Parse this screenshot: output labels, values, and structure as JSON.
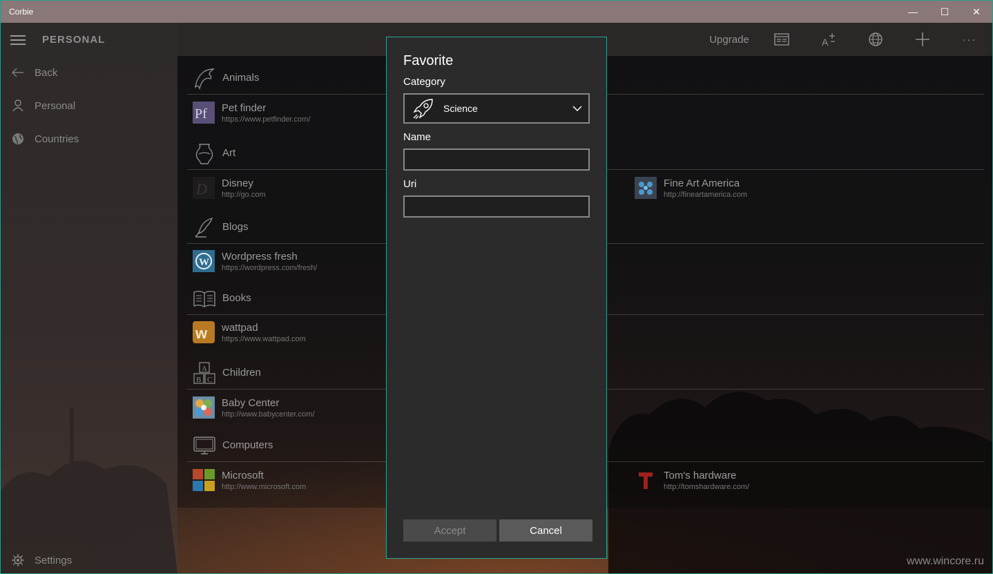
{
  "window": {
    "title": "Corbie",
    "minimize": "—",
    "maximize": "☐",
    "close": "✕"
  },
  "sidebar": {
    "section_title": "PERSONAL",
    "items": [
      {
        "label": "Back",
        "icon": "back-arrow-icon"
      },
      {
        "label": "Personal",
        "icon": "person-icon"
      },
      {
        "label": "Countries",
        "icon": "globe-icon"
      }
    ],
    "settings_label": "Settings"
  },
  "toolbar": {
    "upgrade_label": "Upgrade",
    "more_label": "···"
  },
  "categories": [
    {
      "label": "Animals",
      "icon": "dolphin-icon"
    },
    {
      "label": "Art",
      "icon": "vase-icon"
    },
    {
      "label": "Blogs",
      "icon": "quill-icon"
    },
    {
      "label": "Books",
      "icon": "open-book-icon"
    },
    {
      "label": "Children",
      "icon": "abc-blocks-icon"
    },
    {
      "label": "Computers",
      "icon": "monitor-icon"
    }
  ],
  "favorites": [
    {
      "name": "Pet finder",
      "url": "https://www.petfinder.com/",
      "icon": "petfinder-logo"
    },
    {
      "name": "Disney",
      "url": "http://go.com",
      "icon": "disney-logo"
    },
    {
      "name": "Fine Art America",
      "url": "http://fineartamerica.com",
      "icon": "fineartamerica-logo"
    },
    {
      "name": "Wordpress fresh",
      "url": "https://wordpress.com/fresh/",
      "icon": "wordpress-logo"
    },
    {
      "name": "wattpad",
      "url": "https://www.wattpad.com",
      "icon": "wattpad-logo"
    },
    {
      "name": "Baby Center",
      "url": "http://www.babycenter.com/",
      "icon": "babycenter-logo"
    },
    {
      "name": "Microsoft",
      "url": "http://www.microsoft.com",
      "icon": "microsoft-logo"
    },
    {
      "name": "Tom's hardware",
      "url": "http://tomshardware.com/",
      "icon": "tomshardware-logo"
    }
  ],
  "dialog": {
    "title": "Favorite",
    "category_label": "Category",
    "category_value": "Science",
    "category_icon": "rocket-icon",
    "name_label": "Name",
    "name_value": "",
    "uri_label": "Uri",
    "uri_value": "",
    "accept_label": "Accept",
    "cancel_label": "Cancel"
  },
  "watermark": "www.wincore.ru",
  "colors": {
    "accent": "#2aa592",
    "titlebar": "#8a7777",
    "dialog_bg": "#2b2b2b"
  }
}
